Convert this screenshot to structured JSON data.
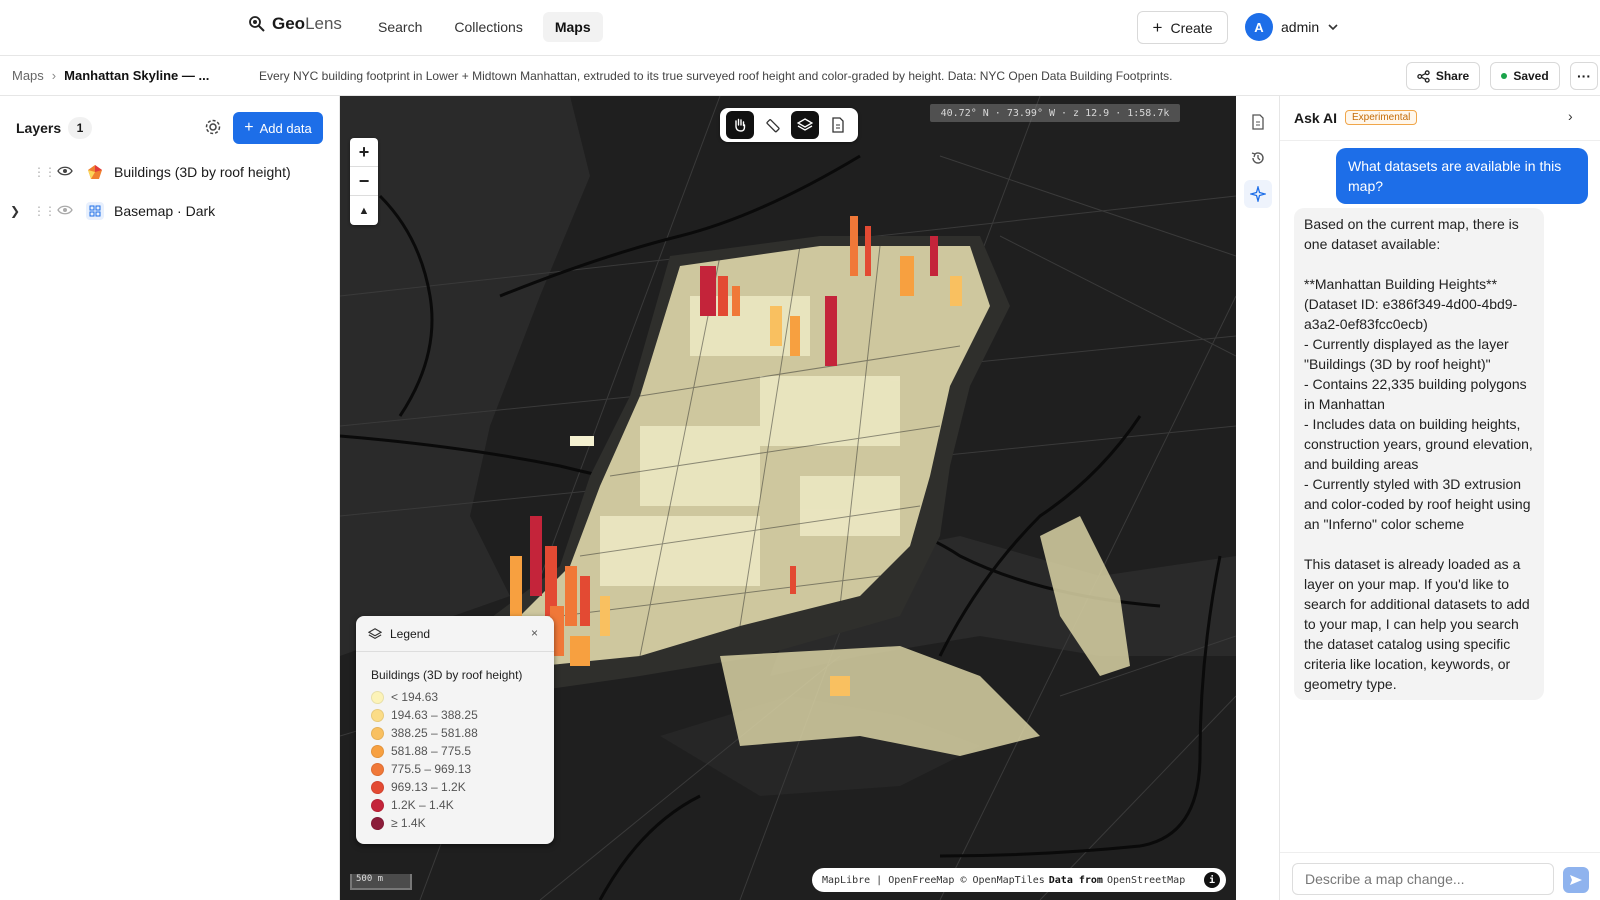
{
  "app": {
    "brand_bold": "Geo",
    "brand_light": "Lens"
  },
  "nav": {
    "items": [
      "Search",
      "Collections",
      "Maps"
    ],
    "active": "Maps"
  },
  "header": {
    "create_label": "Create",
    "user_initial": "A",
    "user_name": "admin"
  },
  "subheader": {
    "crumb_root": "Maps",
    "crumb_current": "Manhattan Skyline — ...",
    "description": "Every NYC building footprint in Lower + Midtown Manhattan, extruded to its true surveyed roof height and color-graded by height. Data: NYC Open Data Building Footprints.",
    "share_label": "Share",
    "saved_label": "Saved",
    "more_label": "···"
  },
  "layers_panel": {
    "title": "Layers",
    "count": "1",
    "add_data_label": "Add data",
    "layers": [
      {
        "name": "Buildings (3D by roof height)",
        "icon": "polygon-icon"
      },
      {
        "name": "Basemap · Dark",
        "icon": "grid-icon"
      }
    ]
  },
  "map": {
    "coords": "40.72° N · 73.99° W · z 12.9 · 1:58.7k",
    "scale_label": "500 m",
    "attribution": {
      "left": "MapLibre | OpenFreeMap © OpenMapTiles",
      "bold": "Data from",
      "right": "OpenStreetMap"
    },
    "zoom_in": "+",
    "zoom_out": "−",
    "tools": [
      "hand-icon",
      "ruler-icon",
      "layers-icon",
      "document-icon"
    ]
  },
  "legend": {
    "title": "Legend",
    "close": "×",
    "layer_name": "Buildings (3D by roof height)",
    "items": [
      {
        "label": "< 194.63",
        "color": "#fcf3b8"
      },
      {
        "label": "194.63 – 388.25",
        "color": "#fbdc87"
      },
      {
        "label": "388.25 – 581.88",
        "color": "#f9c060"
      },
      {
        "label": "581.88 – 775.5",
        "color": "#f7a040"
      },
      {
        "label": "775.5 – 969.13",
        "color": "#f07838"
      },
      {
        "label": "969.13 – 1.2K",
        "color": "#e34a33"
      },
      {
        "label": "1.2K – 1.4K",
        "color": "#c4243a"
      },
      {
        "label": "≥ 1.4K",
        "color": "#8c1c3a"
      }
    ]
  },
  "ai_panel": {
    "title": "Ask AI",
    "badge": "Experimental",
    "user_message": "What datasets are available in this map?",
    "ai_message": "Based on the current map, there is one dataset available:\n\n**Manhattan Building Heights** (Dataset ID: e386f349-4d00-4bd9-a3a2-0ef83fcc0ecb)\n- Currently displayed as the layer \"Buildings (3D by roof height)\"\n- Contains 22,335 building polygons in Manhattan\n- Includes data on building heights, construction years, ground elevation, and building areas\n- Currently styled with 3D extrusion and color-coded by roof height using an \"Inferno\" color scheme\n\nThis dataset is already loaded as a layer on your map. If you'd like to search for additional datasets to add to your map, I can help you search the dataset catalog using specific criteria like location, keywords, or geometry type.",
    "input_placeholder": "Describe a map change..."
  },
  "colors": {
    "accent": "#1d6ee8",
    "map_bg": "#1d1d1d",
    "water": "#252525"
  }
}
